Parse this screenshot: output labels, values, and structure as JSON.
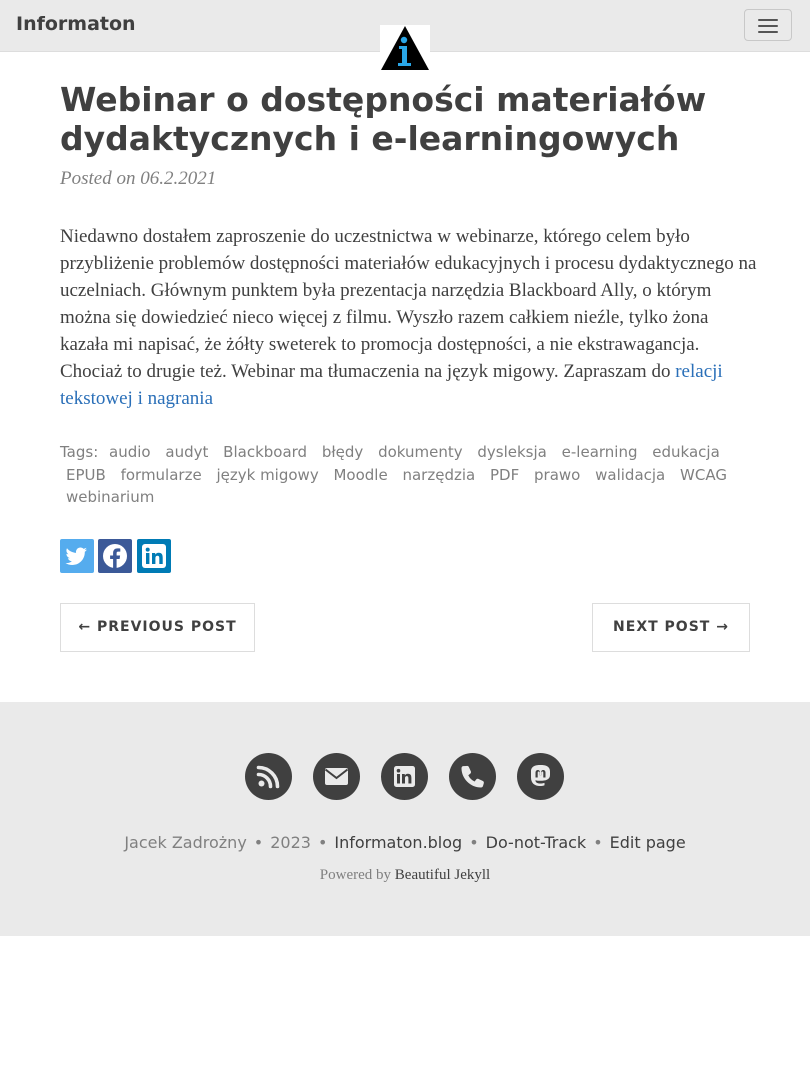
{
  "nav": {
    "brand": "Informaton",
    "menu_icon": "hamburger-menu-icon",
    "logo_icon": "info-triangle-logo"
  },
  "post": {
    "title": "Webinar o dostępności materiałów dydaktycznych i e-learningowych",
    "posted": "Posted on 06.2.2021",
    "body": "Niedawno dostałem zaproszenie do uczestnictwa w webinarze, którego celem było przybliżenie problemów dostępności materiałów edukacyjnych i procesu dydaktycznego na uczelniach. Głównym punktem była prezentacja narzędzia Blackboard Ally, o którym można się dowiedzieć nieco więcej z filmu. Wyszło razem całkiem nieźle, tylko żona kazała mi napisać, że żółty sweterek to promocja dostępności, a nie ekstrawagancja. Chociaż to drugie też. Webinar ma tłumaczenia na język migowy. Zapraszam do",
    "link": "relacji tekstowej i nagrania"
  },
  "tags": {
    "label": "Tags:",
    "items": [
      "audio",
      "audyt",
      "Blackboard",
      "błędy",
      "dokumenty",
      "dysleksja",
      "e-learning",
      "edukacja",
      "EPUB",
      "formularze",
      "język migowy",
      "Moodle",
      "narzędzia",
      "PDF",
      "prawo",
      "walidacja",
      "WCAG",
      "webinarium"
    ]
  },
  "share": {
    "icons": [
      "twitter-icon",
      "facebook-icon",
      "linkedin-icon"
    ],
    "colors": {
      "twitter": "#55acee",
      "facebook": "#3b5998",
      "linkedin": "#007bb5"
    }
  },
  "pager": {
    "previous": "← PREVIOUS POST",
    "next": "NEXT POST →"
  },
  "footer": {
    "icons": [
      "rss-icon",
      "envelope-icon",
      "linkedin-icon",
      "phone-icon",
      "mastodon-icon"
    ],
    "author": "Jacek Zadrożny",
    "year": "2023",
    "site": "Informaton.blog",
    "dnt": "Do-not-Track",
    "edit": "Edit page",
    "powered_prefix": "Powered by",
    "powered_name": "Beautiful Jekyll"
  }
}
